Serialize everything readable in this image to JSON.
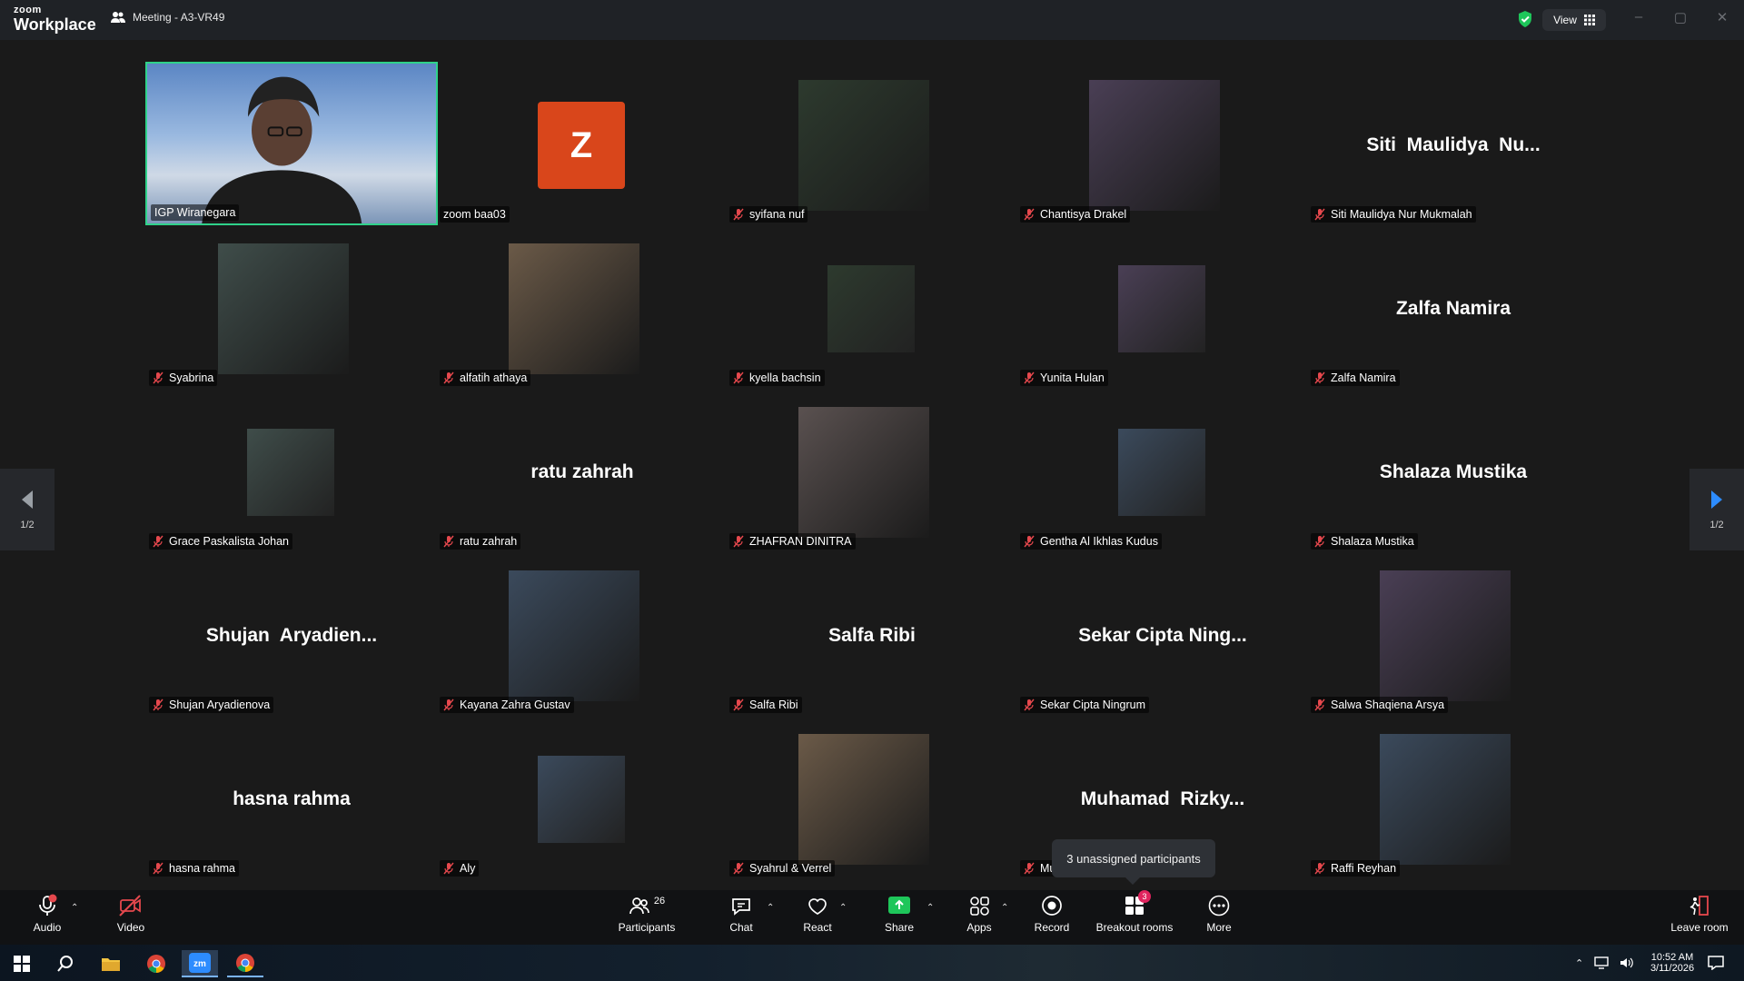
{
  "window": {
    "app_logo_top": "zoom",
    "app_logo_bottom": "Workplace",
    "meeting_title": "Meeting - A3-VR49",
    "view_label": "View"
  },
  "tiles": [
    {
      "name": "IGP Wiranegara",
      "big": "",
      "active": true,
      "muted": false,
      "thumb": "video"
    },
    {
      "name": "zoom baa03",
      "big": "",
      "muted": false,
      "thumb": "avatar",
      "avatar_letter": "Z"
    },
    {
      "name": "syifana nuf",
      "big": "",
      "muted": true,
      "thumb": "photo"
    },
    {
      "name": "Chantisya Drakel",
      "big": "",
      "muted": true,
      "thumb": "photo"
    },
    {
      "name": "Siti Maulidya Nur Mukmalah",
      "big": "Siti  Maulidya  Nu...",
      "muted": true,
      "thumb": "none"
    },
    {
      "name": "Syabrina",
      "big": "",
      "muted": true,
      "thumb": "photo"
    },
    {
      "name": "alfatih athaya",
      "big": "",
      "muted": true,
      "thumb": "photo"
    },
    {
      "name": "kyella bachsin",
      "big": "",
      "muted": true,
      "thumb": "photo-sm"
    },
    {
      "name": "Yunita Hulan",
      "big": "",
      "muted": true,
      "thumb": "photo-sm"
    },
    {
      "name": "Zalfa Namira",
      "big": "Zalfa Namira",
      "muted": true,
      "thumb": "none"
    },
    {
      "name": "Grace Paskalista Johan",
      "big": "",
      "muted": true,
      "thumb": "photo-sm"
    },
    {
      "name": "ratu zahrah",
      "big": "ratu zahrah",
      "muted": true,
      "thumb": "none"
    },
    {
      "name": "ZHAFRAN DINITRA",
      "big": "",
      "muted": true,
      "thumb": "photo"
    },
    {
      "name": "Gentha Al Ikhlas Kudus",
      "big": "",
      "muted": true,
      "thumb": "photo-sm"
    },
    {
      "name": "Shalaza Mustika",
      "big": "Shalaza Mustika",
      "muted": true,
      "thumb": "none"
    },
    {
      "name": "Shujan Aryadienova",
      "big": "Shujan  Aryadien...",
      "muted": true,
      "thumb": "none"
    },
    {
      "name": "Kayana Zahra Gustav",
      "big": "",
      "muted": true,
      "thumb": "photo"
    },
    {
      "name": "Salfa Ribi",
      "big": "Salfa Ribi",
      "muted": true,
      "thumb": "none"
    },
    {
      "name": "Sekar Cipta Ningrum",
      "big": "Sekar Cipta Ning...",
      "muted": true,
      "thumb": "none"
    },
    {
      "name": "Salwa Shaqiena Arsya",
      "big": "",
      "muted": true,
      "thumb": "photo"
    },
    {
      "name": "hasna rahma",
      "big": "hasna rahma",
      "muted": true,
      "thumb": "none"
    },
    {
      "name": "Aly",
      "big": "",
      "muted": true,
      "thumb": "photo-sm"
    },
    {
      "name": "Syahrul & Verrel",
      "big": "",
      "muted": true,
      "thumb": "photo"
    },
    {
      "name": "Mu",
      "big": "Muhamad  Rizky...",
      "muted": true,
      "thumb": "none"
    },
    {
      "name": "Raffi Reyhan",
      "big": "",
      "muted": true,
      "thumb": "photo"
    }
  ],
  "pager": {
    "left_label": "1/2",
    "right_label": "1/2"
  },
  "tooltip": "3 unassigned participants",
  "toolbar": {
    "audio": "Audio",
    "video": "Video",
    "participants": "Participants",
    "participants_count": "26",
    "chat": "Chat",
    "react": "React",
    "share": "Share",
    "apps": "Apps",
    "record": "Record",
    "breakout": "Breakout rooms",
    "breakout_badge": "3",
    "more": "More",
    "leave": "Leave room"
  },
  "taskbar": {
    "time": "10:52 AM",
    "date": "3/11/2026"
  },
  "colors": {
    "active_border": "#2fd28a",
    "avatar_bg": "#d9461b",
    "share_green": "#1ec65a",
    "mute_red": "#e5484d"
  }
}
